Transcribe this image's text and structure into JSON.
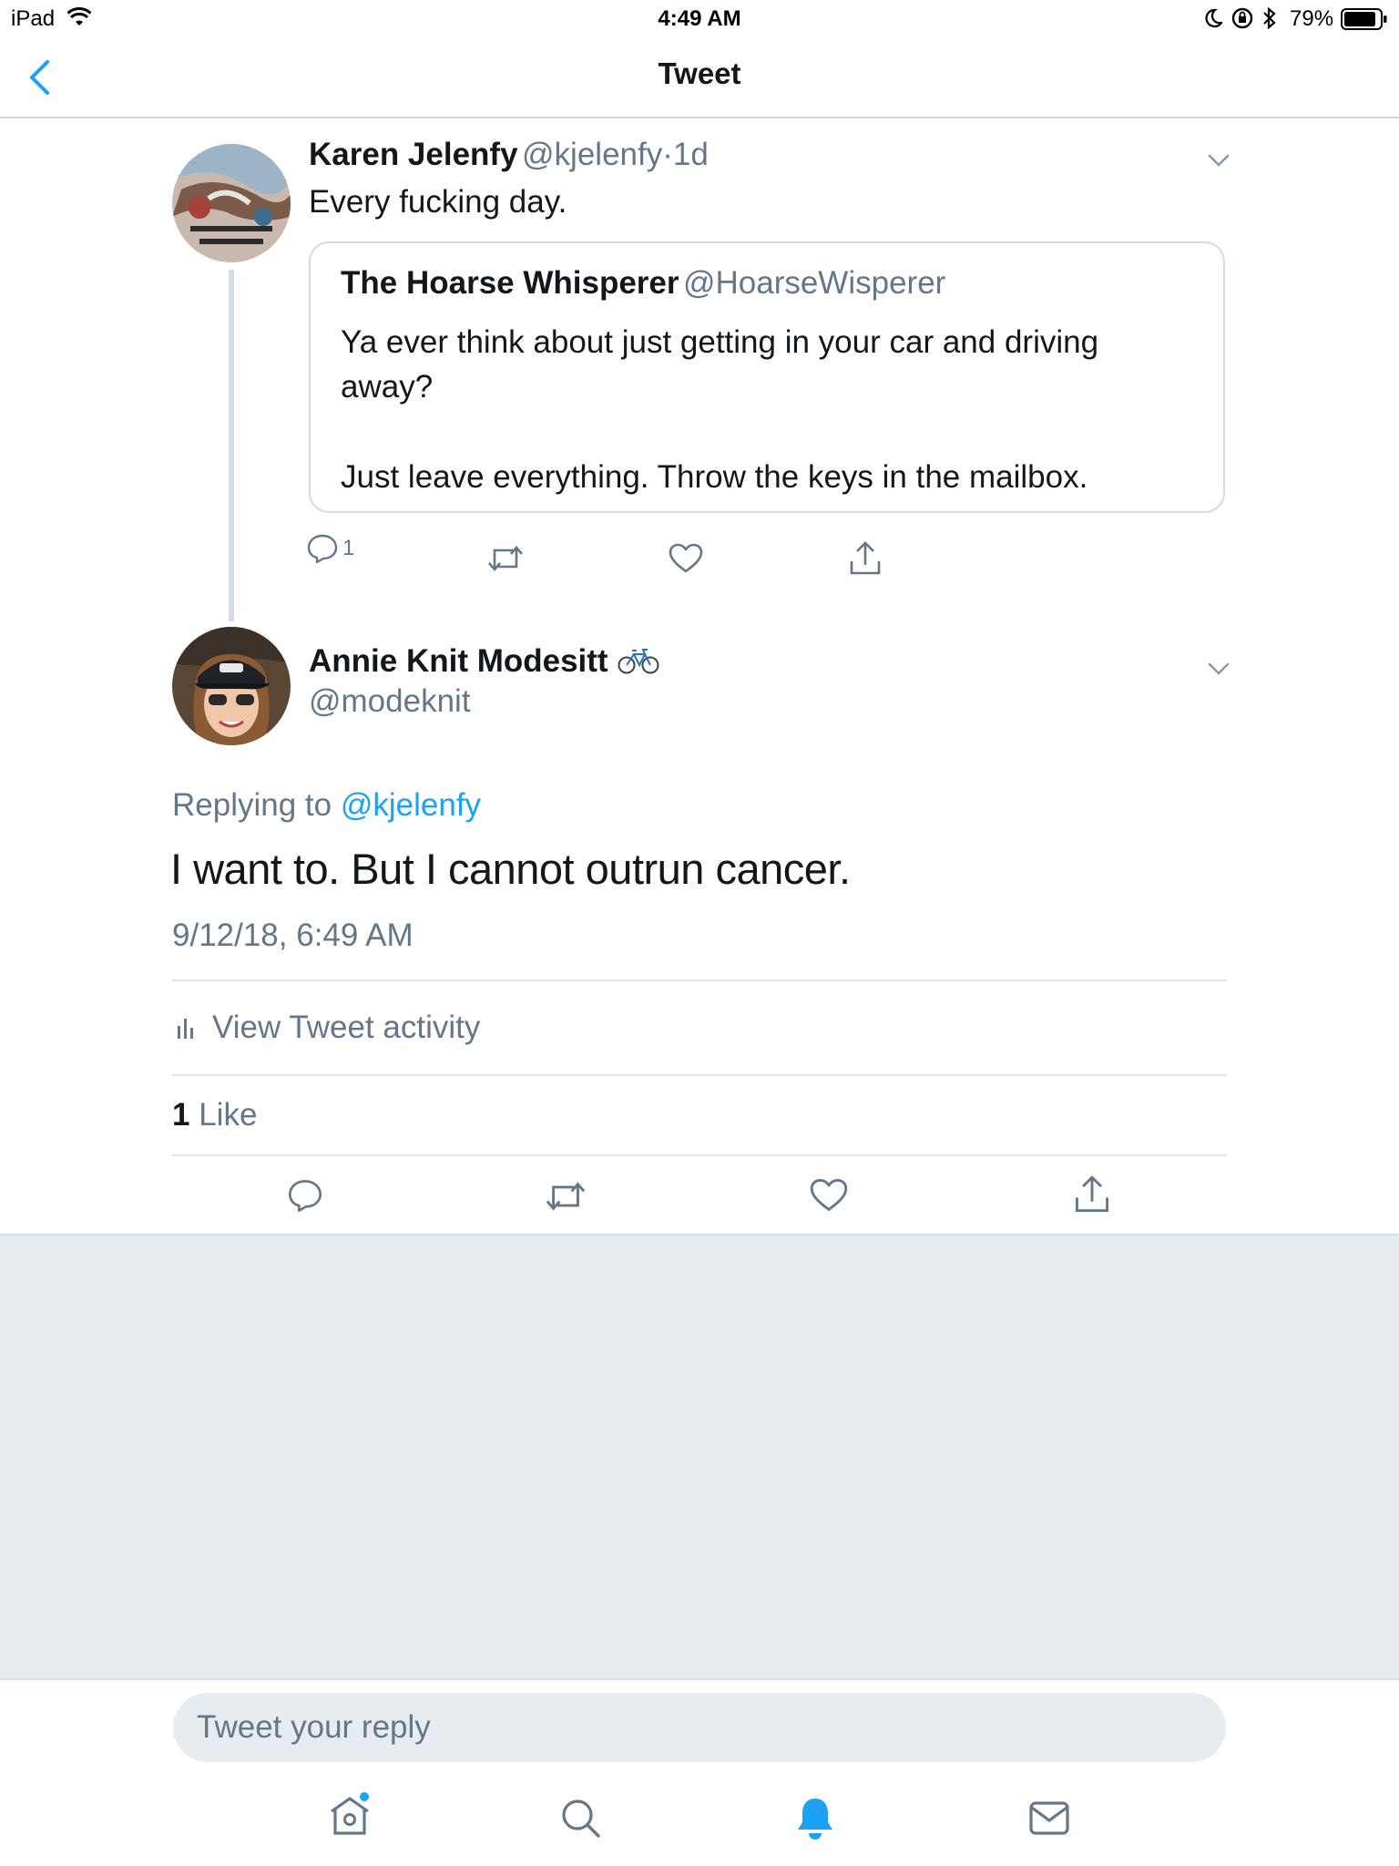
{
  "status_bar": {
    "device": "iPad",
    "time": "4:49 AM",
    "battery": "79%"
  },
  "nav": {
    "title": "Tweet"
  },
  "parent_tweet": {
    "name": "Karen Jelenfy",
    "handle": "@kjelenfy",
    "separator": "·",
    "age": "1d",
    "text": "Every fucking day.",
    "quote": {
      "name": "The Hoarse Whisperer",
      "handle": "@HoarseWisperer",
      "line1": "Ya ever think about just getting in your car and driving",
      "line2": "away?",
      "line3": "Just leave everything. Throw the keys in the mailbox."
    },
    "reply_count": "1"
  },
  "main_tweet": {
    "name": "Annie Knit Modesitt",
    "emoji": "🚲",
    "handle": "@modeknit",
    "replying_prefix": "Replying to",
    "replying_handle": "@kjelenfy",
    "text": "I want to. But I cannot outrun cancer.",
    "timestamp": "9/12/18, 6:49 AM",
    "activity_label": "View Tweet activity",
    "likes_count": "1",
    "likes_label": "Like"
  },
  "reply": {
    "placeholder": "Tweet your reply"
  },
  "colors": {
    "accent": "#1da1f2",
    "muted": "#657786",
    "divider": "#e1e8ed",
    "background_empty": "#e6ecf0"
  },
  "icons": [
    "back-chevron-icon",
    "wifi-icon",
    "moon-icon",
    "rotation-lock-icon",
    "bluetooth-icon",
    "battery-icon",
    "chevron-down-icon",
    "reply-icon",
    "retweet-icon",
    "like-icon",
    "share-icon",
    "analytics-icon",
    "home-icon",
    "search-icon",
    "notifications-bell-icon",
    "messages-icon"
  ]
}
